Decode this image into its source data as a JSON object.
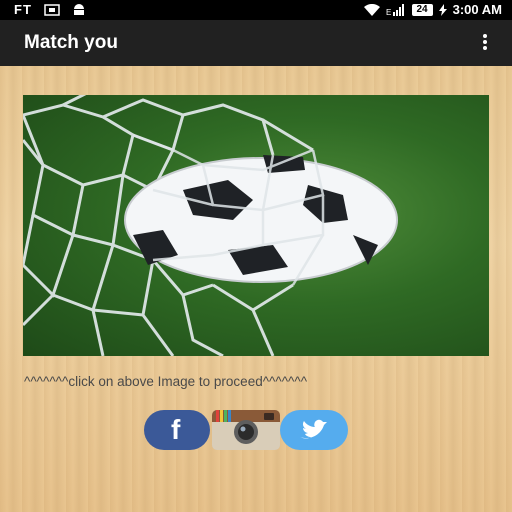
{
  "status_bar": {
    "carrier": "FT",
    "battery": "24",
    "time": "3:00 AM",
    "icons": [
      "screenshot-icon",
      "android-icon",
      "wifi-icon",
      "signal-icon",
      "battery-icon",
      "charging-icon"
    ]
  },
  "app_bar": {
    "title": "Match you",
    "menu_icon": "overflow-menu-icon"
  },
  "main": {
    "image_icon": "soccer-ball-in-net-image",
    "hint": "^^^^^^^click on above Image to proceed^^^^^^^"
  },
  "social": [
    {
      "name": "facebook",
      "label": "f",
      "color": "#3b5998"
    },
    {
      "name": "instagram",
      "color": "#c9b9a2"
    },
    {
      "name": "twitter",
      "color": "#55acee"
    }
  ]
}
